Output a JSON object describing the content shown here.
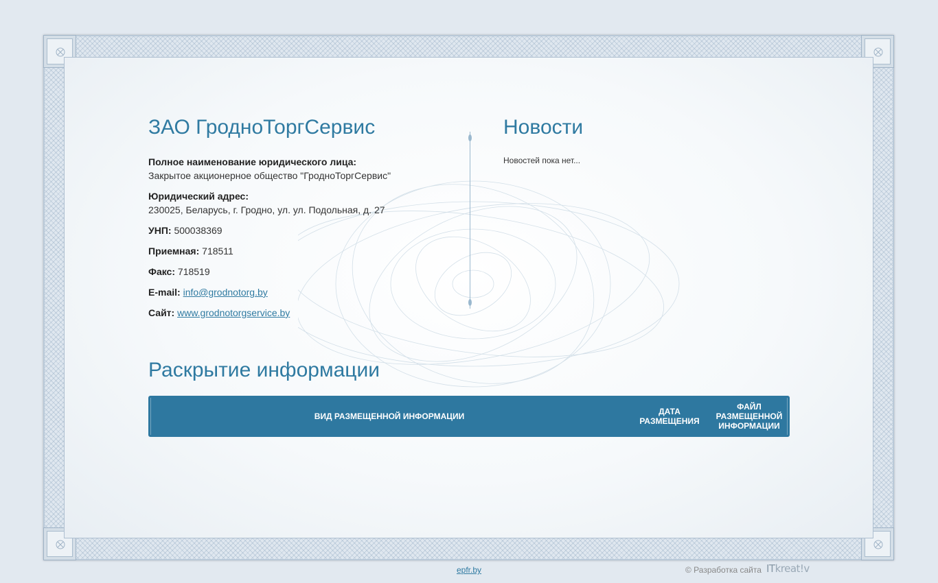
{
  "company": {
    "title": "ЗАО ГродноТоргСервис",
    "full_name_label": "Полное наименование юридического лица:",
    "full_name_value": "Закрытое акционерное общество \"ГродноТоргСервис\"",
    "address_label": "Юридический адрес:",
    "address_value": "230025, Беларусь, г. Гродно, ул. ул. Подольная, д. 27",
    "unp_label": "УНП:",
    "unp_value": "500038369",
    "reception_label": "Приемная:",
    "reception_value": "718511",
    "fax_label": "Факс:",
    "fax_value": "718519",
    "email_label": "E-mail:",
    "email_value": "info@grodnotorg.by",
    "site_label": "Сайт:",
    "site_value": "www.grodnotorgservice.by"
  },
  "news": {
    "title": "Новости",
    "empty_text": "Новостей пока нет..."
  },
  "disclosure": {
    "title": "Раскрытие информации",
    "columns": [
      "Вид размещенной информации",
      "Дата размещения",
      "Файл размещенной информации"
    ]
  },
  "footer": {
    "link": "epfr.by",
    "credit": "© Разработка сайта",
    "logo_it": "IT",
    "logo_rest": "kreat!v"
  },
  "colors": {
    "accent": "#2f7aa1",
    "table_header": "#2e78a0",
    "page_bg": "#e2e9f0"
  }
}
